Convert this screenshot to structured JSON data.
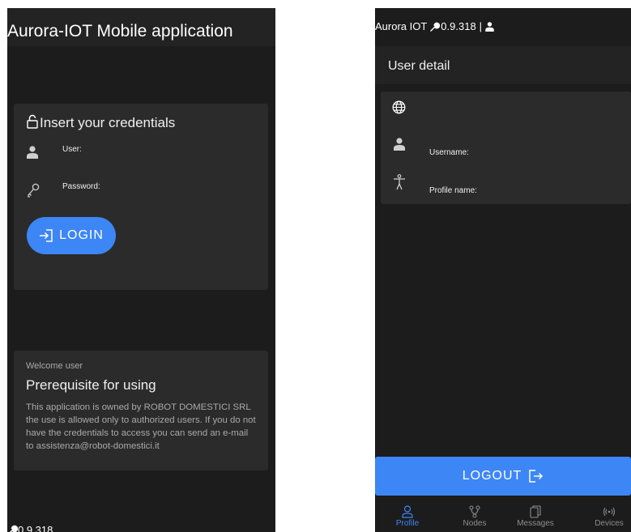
{
  "login_screen": {
    "app_title": "Aurora-IOT Mobile application",
    "credentials_title": "Insert your credentials",
    "user_label": "User:",
    "password_label": "Password:",
    "login_button": "LOGIN",
    "welcome_small": "Welcome user",
    "welcome_heading": "Prerequisite for using",
    "welcome_body": "This application is owned by ROBOT DOMESTICI SRL the use is allowed only to authorized users. If you do not have the credentials to access you can send an e-mail to assistenza@robot-domestici.it",
    "version": "0.9.318"
  },
  "profile_screen": {
    "header_prefix": "Aurora IOT",
    "header_version": "0.9.318",
    "header_separator": "|",
    "section_title": "User detail",
    "username_label": "Username:",
    "profile_name_label": "Profile name:",
    "logout_button": "LOGOUT",
    "bottom_nav": [
      "Profile",
      "Nodes",
      "Messages",
      "Devices"
    ]
  },
  "colors": {
    "accent": "#3d86f6",
    "background": "#1c1c1c",
    "card": "#2b2b2b",
    "nav_inactive": "#8d8d8d"
  },
  "icons": [
    "lock-icon",
    "person-icon",
    "key-icon",
    "login-icon",
    "wrench-icon",
    "globe-icon",
    "accessibility-icon",
    "logout-icon",
    "profile-nav-icon",
    "nodes-nav-icon",
    "messages-nav-icon",
    "devices-nav-icon"
  ]
}
